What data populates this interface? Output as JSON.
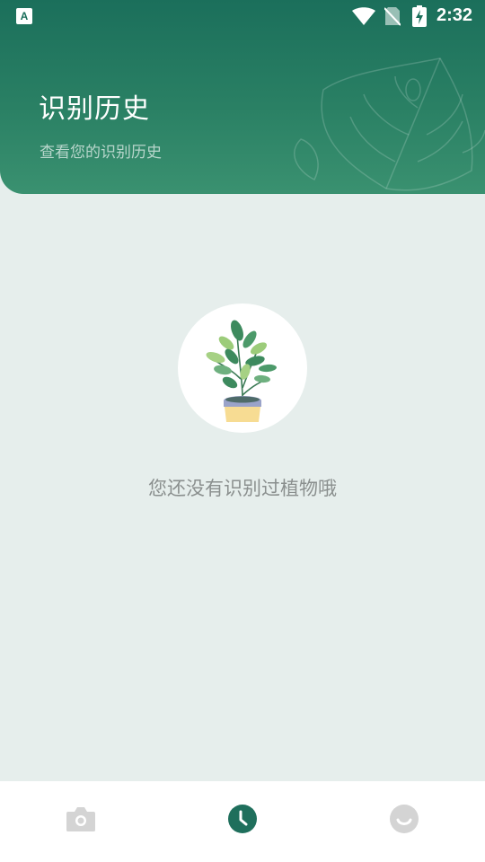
{
  "status_bar": {
    "time": "2:32",
    "icons": [
      "notification-a-icon",
      "wifi-icon",
      "no-sim-icon",
      "battery-charging-icon"
    ]
  },
  "header": {
    "title": "识别历史",
    "subtitle": "查看您的识别历史"
  },
  "empty_state": {
    "illustration": "potted-plant-icon",
    "message": "您还没有识别过植物哦"
  },
  "bottom_nav": {
    "items": [
      {
        "icon": "camera-icon",
        "active": false
      },
      {
        "icon": "clock-icon",
        "active": true
      },
      {
        "icon": "smile-icon",
        "active": false
      }
    ]
  },
  "colors": {
    "header_top": "#1b6f5b",
    "header_bottom": "#3a9170",
    "background": "#e6eeec",
    "active_nav": "#1f6f5c",
    "inactive_nav": "#d4d4d4",
    "empty_text": "#8a8f8e"
  }
}
